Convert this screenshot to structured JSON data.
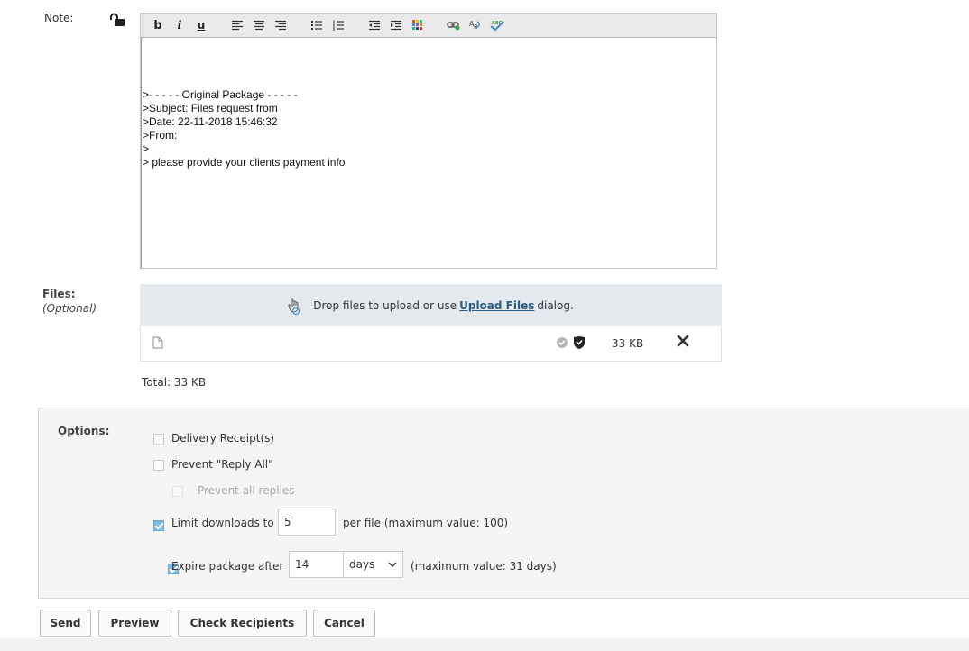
{
  "note": {
    "label": "Note:",
    "lines": [
      ">- - - - - Original Package - - - - -",
      ">Subject: Files request from",
      ">Date: 22-11-2018 15:46:32",
      ">From:",
      ">",
      "> please provide your clients payment info"
    ]
  },
  "toolbar": {
    "bold": "b",
    "italic": "i",
    "underline": "u"
  },
  "files": {
    "label": "Files:",
    "optional": "(Optional)",
    "drop_text_before": "Drop files to upload or use",
    "drop_link": "Upload Files",
    "drop_text_after": "dialog.",
    "file_size": "33 KB",
    "total": "Total: 33 KB"
  },
  "options": {
    "label": "Options:",
    "delivery_receipts": "Delivery Receipt(s)",
    "prevent_reply_all": "Prevent \"Reply All\"",
    "prevent_all_replies": "Prevent all replies",
    "limit_downloads_label": "Limit downloads to",
    "limit_downloads_value": "5",
    "limit_downloads_suffix": "per file (maximum value: 100)",
    "expire_label": "Expire package after",
    "expire_value": "14",
    "expire_unit": "days",
    "expire_suffix": "(maximum value: 31 days)"
  },
  "buttons": {
    "send": "Send",
    "preview": "Preview",
    "check_recipients": "Check Recipients",
    "cancel": "Cancel"
  }
}
